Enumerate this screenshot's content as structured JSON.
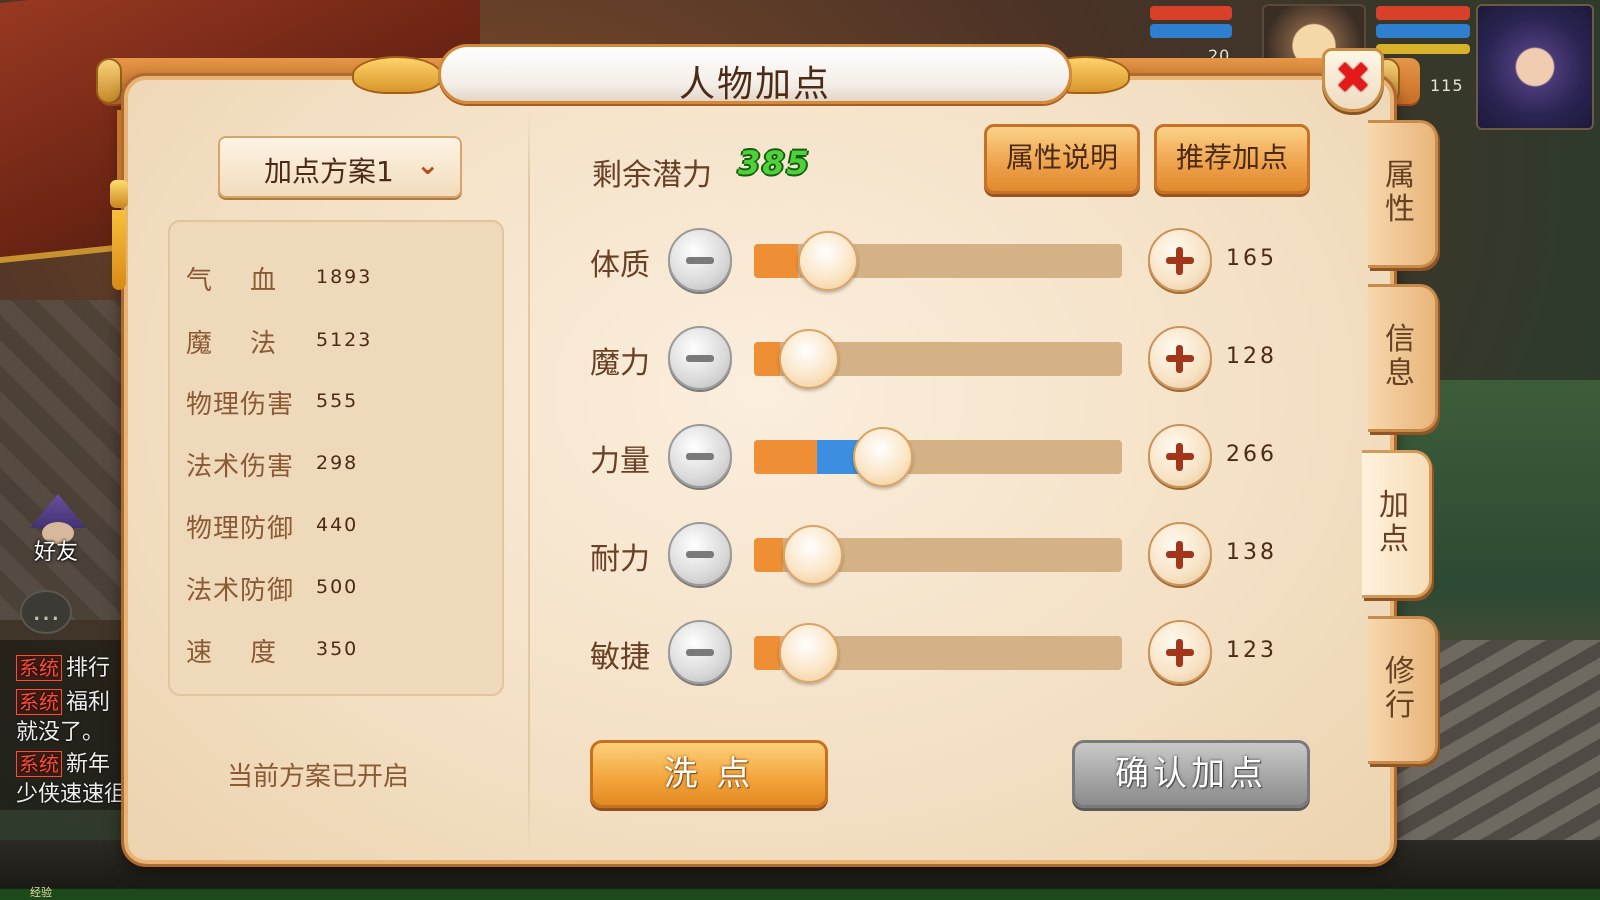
{
  "hud": {
    "pet_level": "20",
    "hero_level": "115"
  },
  "left_hud": {
    "friend_label": "好友",
    "chat": [
      {
        "tag": "系统",
        "text": "排行"
      },
      {
        "tag": "系统",
        "text": "福利"
      },
      {
        "tag": "",
        "text": "就没了。"
      },
      {
        "tag": "系统",
        "text": "新年"
      },
      {
        "tag": "",
        "text": "少侠速速徂"
      }
    ],
    "exp_label": "经验"
  },
  "dialog": {
    "title": "人物加点",
    "close_glyph": "✖",
    "plan_dropdown": {
      "label": "加点方案1",
      "chevron": "⌄"
    },
    "stats": [
      {
        "label": "气    血",
        "value": "1893"
      },
      {
        "label": "魔    法",
        "value": "5123"
      },
      {
        "label": "物理伤害",
        "value": "555"
      },
      {
        "label": "法术伤害",
        "value": "298"
      },
      {
        "label": "物理防御",
        "value": "440"
      },
      {
        "label": "法术防御",
        "value": "500"
      },
      {
        "label": "速    度",
        "value": "350"
      }
    ],
    "plan_status": "当前方案已开启",
    "potential": {
      "label": "剩余潜力",
      "value": "385"
    },
    "buttons": {
      "attr_info": "属性说明",
      "recommend": "推荐加点",
      "reset": "洗 点",
      "confirm": "确认加点"
    },
    "attributes": [
      {
        "label": "体质",
        "value": "165",
        "base_fraction": 0.12,
        "added_fraction": 0.0,
        "knob_fraction": 0.2
      },
      {
        "label": "魔力",
        "value": "128",
        "base_fraction": 0.07,
        "added_fraction": 0.0,
        "knob_fraction": 0.15
      },
      {
        "label": "力量",
        "value": "266",
        "base_fraction": 0.17,
        "added_fraction": 0.12,
        "knob_fraction": 0.35
      },
      {
        "label": "耐力",
        "value": "138",
        "base_fraction": 0.08,
        "added_fraction": 0.0,
        "knob_fraction": 0.16
      },
      {
        "label": "敏捷",
        "value": "123",
        "base_fraction": 0.07,
        "added_fraction": 0.0,
        "knob_fraction": 0.15
      }
    ],
    "side_tabs": [
      {
        "label": "属性",
        "active": false
      },
      {
        "label": "信息",
        "active": false
      },
      {
        "label": "加点",
        "active": true
      },
      {
        "label": "修行",
        "active": false
      }
    ]
  },
  "colors": {
    "potential_green": "#4ed13a",
    "fill_orange": "#ee8f35",
    "fill_added_blue": "#3c8fe0",
    "close_red": "#e41a1a"
  }
}
